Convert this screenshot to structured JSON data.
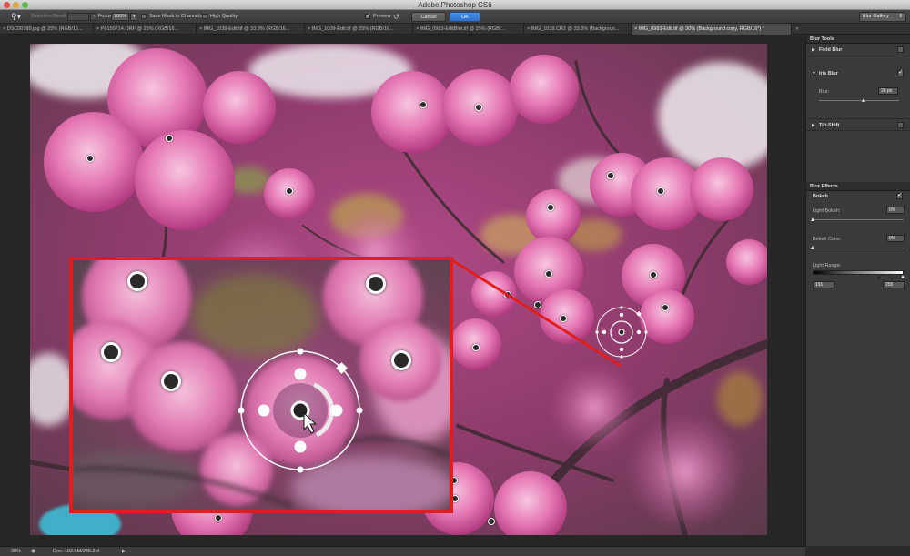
{
  "window": {
    "title": "Adobe Photoshop CS6"
  },
  "options_bar": {
    "selection_bleed_label": "Selection Bleed:",
    "focus_label": "Focus:",
    "focus_value": "100%",
    "save_mask_label": "Save Mask to Channels",
    "high_quality_label": "High Quality",
    "preview_label": "Preview",
    "preview_checked": true,
    "cancel_label": "Cancel",
    "ok_label": "OK",
    "workspace_value": "Blur Gallery"
  },
  "tabs": [
    {
      "label": "DSC00389.jpg @ 25% (RGB/16..."
    },
    {
      "label": "P6150714.ORF @ 25% (RGB/16..."
    },
    {
      "label": "IMG_1038-Edit.tif @ 33.3% (RGB/16..."
    },
    {
      "label": "IMG_1009-Edit.tif @ 25% (RGB/16..."
    },
    {
      "label": "IMG_0983-EditBlur.tif @ 25% (RGB/..."
    },
    {
      "label": "IMG_1038.CR2 @ 33.3% (Backgroun..."
    },
    {
      "label": "IMG_0983-Edit.tif @ 30% (Background copy, RGB/16*) *"
    }
  ],
  "blur_tools": {
    "header": "Blur Tools",
    "field_blur": {
      "label": "Field Blur",
      "checked": false
    },
    "iris_blur": {
      "label": "Iris Blur",
      "checked": true,
      "blur_label": "Blur:",
      "blur_value": "28 px",
      "blur_fraction": 0.56
    },
    "tilt_shift": {
      "label": "Tilt-Shift",
      "checked": false
    }
  },
  "blur_effects": {
    "header": "Blur Effects",
    "bokeh_label": "Bokeh",
    "bokeh_checked": true,
    "light_bokeh_label": "Light Bokeh:",
    "light_bokeh_value": "0%",
    "bokeh_color_label": "Bokeh Color:",
    "bokeh_color_value": "0%",
    "light_range_label": "Light Range:",
    "light_range_low": "191",
    "light_range_high": "255"
  },
  "status_bar": {
    "zoom": "30%",
    "doc_info": "Doc: 102.5M/235.2M"
  },
  "colors": {
    "highlight_box": "#e01e1e",
    "ok_button": "#2f6fc9"
  }
}
